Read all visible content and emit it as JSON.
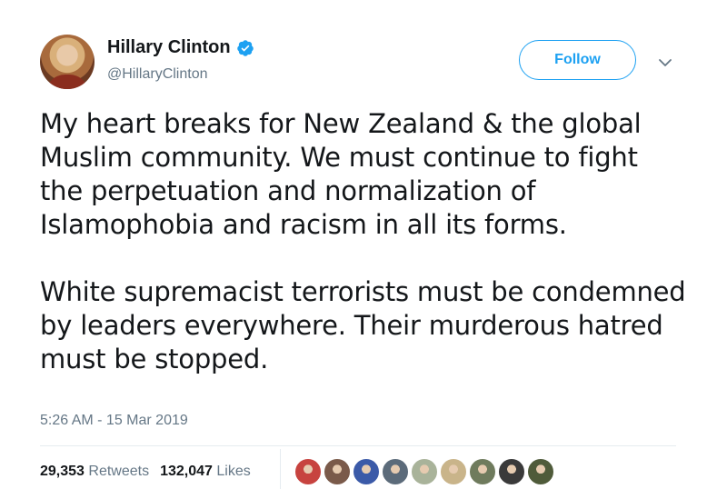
{
  "author": {
    "display_name": "Hillary Clinton",
    "handle": "@HillaryClinton",
    "verified": true
  },
  "follow_button": {
    "label": "Follow"
  },
  "tweet": {
    "paragraphs": [
      "My heart breaks for New Zealand & the global Muslim community. We must continue to fight the perpetuation and normalization of Islamophobia and racism in all its forms.",
      "White supremacist terrorists must be condemned by leaders everywhere. Their murderous hatred must be stopped."
    ],
    "timestamp": "5:26 AM - 15 Mar 2019"
  },
  "stats": {
    "retweets": {
      "count": "29,353",
      "label": "Retweets"
    },
    "likes": {
      "count": "132,047",
      "label": "Likes"
    }
  },
  "liker_avatars": [
    {
      "color": "#c7433f"
    },
    {
      "color": "#7a5a4a"
    },
    {
      "color": "#3b5aa8"
    },
    {
      "color": "#5c6b7a"
    },
    {
      "color": "#a9b39a"
    },
    {
      "color": "#c9b48a"
    },
    {
      "color": "#6f7b5d"
    },
    {
      "color": "#3a3a3a"
    },
    {
      "color": "#4f5b3a"
    }
  ],
  "colors": {
    "accent": "#1da1f2",
    "text": "#14171a",
    "secondary_text": "#657786",
    "divider": "#e6ecf0"
  },
  "icons": {
    "verified": "verified-badge-icon",
    "caret": "chevron-down-icon"
  }
}
